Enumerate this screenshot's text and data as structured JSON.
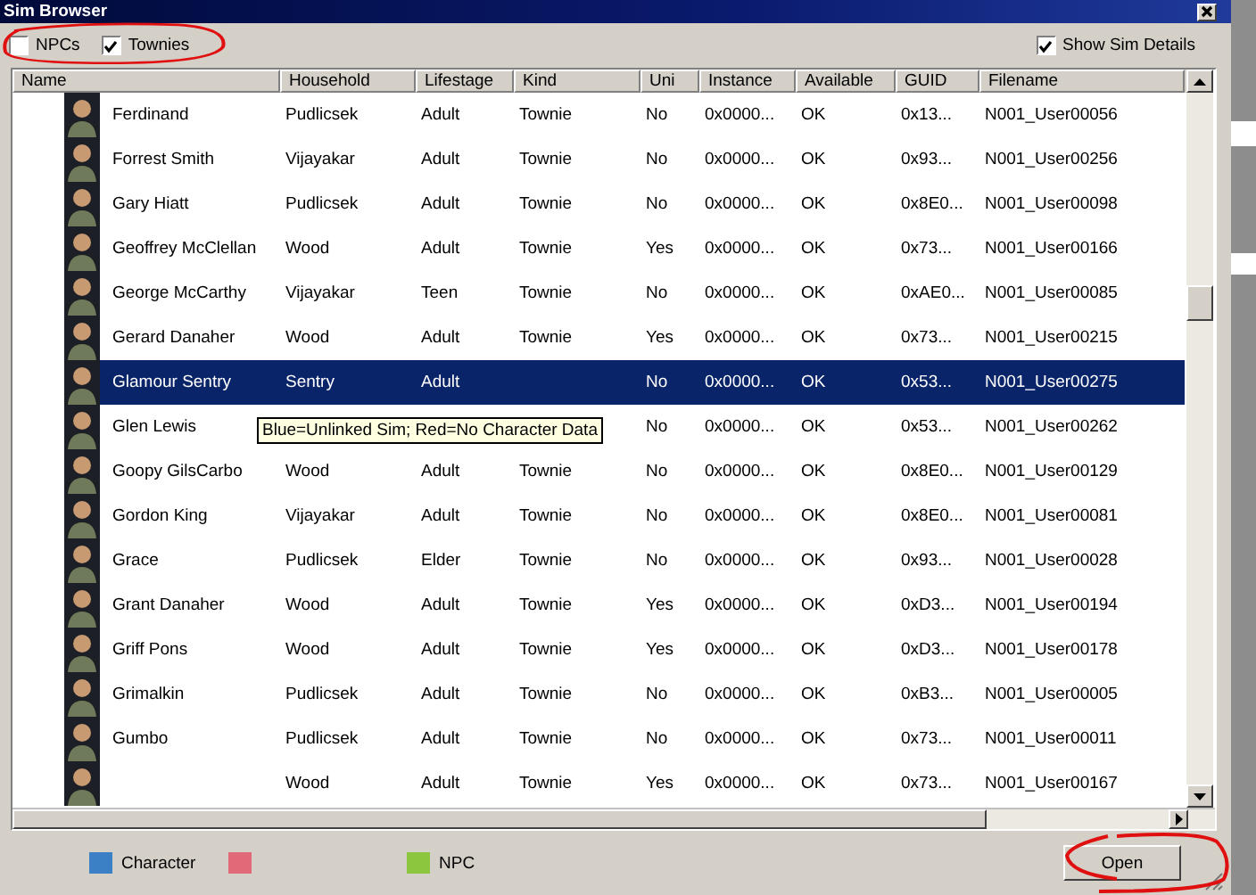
{
  "window": {
    "title": "Sim Browser"
  },
  "filters": [
    {
      "label": "NPCs",
      "checked": false
    },
    {
      "label": "Townies",
      "checked": true
    }
  ],
  "show_sim_details": {
    "label": "Show Sim Details",
    "checked": true
  },
  "table": {
    "columns": [
      "Name",
      "Household",
      "Lifestage",
      "Kind",
      "Uni",
      "Instance",
      "Available",
      "GUID",
      "Filename"
    ],
    "rows": [
      {
        "selected": false,
        "cells": [
          "Ferdinand",
          "Pudlicsek",
          "Adult",
          "Townie",
          "No",
          "0x0000...",
          "OK",
          "0x13...",
          "N001_User00056"
        ]
      },
      {
        "selected": false,
        "cells": [
          "Forrest Smith",
          "Vijayakar",
          "Adult",
          "Townie",
          "No",
          "0x0000...",
          "OK",
          "0x93...",
          "N001_User00256"
        ]
      },
      {
        "selected": false,
        "cells": [
          "Gary Hiatt",
          "Pudlicsek",
          "Adult",
          "Townie",
          "No",
          "0x0000...",
          "OK",
          "0x8E0...",
          "N001_User00098"
        ]
      },
      {
        "selected": false,
        "cells": [
          "Geoffrey McClellan",
          "Wood",
          "Adult",
          "Townie",
          "Yes",
          "0x0000...",
          "OK",
          "0x73...",
          "N001_User00166"
        ]
      },
      {
        "selected": false,
        "cells": [
          "George McCarthy",
          "Vijayakar",
          "Teen",
          "Townie",
          "No",
          "0x0000...",
          "OK",
          "0xAE0...",
          "N001_User00085"
        ]
      },
      {
        "selected": false,
        "cells": [
          "Gerard Danaher",
          "Wood",
          "Adult",
          "Townie",
          "Yes",
          "0x0000...",
          "OK",
          "0x73...",
          "N001_User00215"
        ]
      },
      {
        "selected": true,
        "cells": [
          "Glamour Sentry",
          "Sentry",
          "Adult",
          null,
          "No",
          "0x0000...",
          "OK",
          "0x53...",
          "N001_User00275"
        ]
      },
      {
        "selected": false,
        "cells": [
          "Glen Lewis",
          null,
          null,
          null,
          "No",
          "0x0000...",
          "OK",
          "0x53...",
          "N001_User00262"
        ],
        "tooltip": "Blue=Unlinked Sim; Red=No Character Data"
      },
      {
        "selected": false,
        "cells": [
          "Goopy GilsCarbo",
          "Wood",
          "Adult",
          "Townie",
          "No",
          "0x0000...",
          "OK",
          "0x8E0...",
          "N001_User00129"
        ]
      },
      {
        "selected": false,
        "cells": [
          "Gordon King",
          "Vijayakar",
          "Adult",
          "Townie",
          "No",
          "0x0000...",
          "OK",
          "0x8E0...",
          "N001_User00081"
        ]
      },
      {
        "selected": false,
        "cells": [
          "Grace",
          "Pudlicsek",
          "Elder",
          "Townie",
          "No",
          "0x0000...",
          "OK",
          "0x93...",
          "N001_User00028"
        ]
      },
      {
        "selected": false,
        "cells": [
          "Grant Danaher",
          "Wood",
          "Adult",
          "Townie",
          "Yes",
          "0x0000...",
          "OK",
          "0xD3...",
          "N001_User00194"
        ]
      },
      {
        "selected": false,
        "cells": [
          "Griff Pons",
          "Wood",
          "Adult",
          "Townie",
          "Yes",
          "0x0000...",
          "OK",
          "0xD3...",
          "N001_User00178"
        ]
      },
      {
        "selected": false,
        "cells": [
          "Grimalkin",
          "Pudlicsek",
          "Adult",
          "Townie",
          "No",
          "0x0000...",
          "OK",
          "0xB3...",
          "N001_User00005"
        ]
      },
      {
        "selected": false,
        "cells": [
          "Gumbo",
          "Pudlicsek",
          "Adult",
          "Townie",
          "No",
          "0x0000...",
          "OK",
          "0x73...",
          "N001_User00011"
        ]
      },
      {
        "selected": false,
        "cells": [
          null,
          "Wood",
          "Adult",
          "Townie",
          "Yes",
          "0x0000...",
          "OK",
          "0x73...",
          "N001_User00167"
        ]
      }
    ]
  },
  "legend": [
    {
      "label": "Character",
      "color": "#3b7fc4"
    },
    {
      "color": "#e06a78"
    },
    {
      "label": "NPC",
      "color": "#8cc63f"
    }
  ],
  "buttons": [
    {
      "label": "Open"
    }
  ]
}
